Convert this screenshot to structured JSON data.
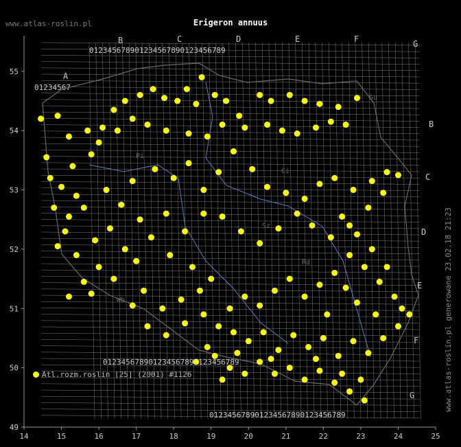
{
  "title": "Erigeron annuus",
  "site_label": "www.atlas-roslin.pl",
  "credit": "www.atlas-roslin.pl generowane 23.02.18 21:23",
  "legend": {
    "label": "Atl.rozm.roslin [25] (2001) #1126",
    "color": "#ffff00"
  },
  "colors": {
    "background": "#000000",
    "grid": "#7f7f7f",
    "dot": "#ffff00",
    "border": "#5f7fc0",
    "axis": "#999999"
  },
  "chart_data": {
    "type": "scatter",
    "xlim": [
      14,
      25
    ],
    "ylim": [
      49,
      55.6
    ],
    "x_ticks": [
      14,
      15,
      16,
      17,
      18,
      19,
      20,
      21,
      22,
      23,
      24,
      25
    ],
    "y_ticks": [
      49,
      50,
      51,
      52,
      53,
      54,
      55
    ],
    "grid_letters_top": [
      "A",
      "B",
      "C",
      "D",
      "E",
      "F",
      "G"
    ],
    "grid_letters_right": [
      "B",
      "C",
      "D",
      "E",
      "F",
      "G"
    ],
    "grid_digits": "0123456789",
    "river_labels": [
      "Su",
      "Pi",
      "Ci",
      "Sz",
      "Rd",
      "Wb"
    ],
    "points": [
      [
        14.45,
        54.2
      ],
      [
        14.9,
        54.25
      ],
      [
        15.2,
        53.9
      ],
      [
        15.7,
        54.0
      ],
      [
        16.0,
        53.8
      ],
      [
        16.1,
        54.05
      ],
      [
        16.4,
        54.35
      ],
      [
        16.7,
        54.5
      ],
      [
        17.1,
        54.6
      ],
      [
        17.45,
        54.7
      ],
      [
        17.75,
        54.55
      ],
      [
        18.1,
        54.5
      ],
      [
        18.35,
        54.7
      ],
      [
        18.75,
        54.9
      ],
      [
        18.6,
        54.45
      ],
      [
        19.1,
        54.6
      ],
      [
        19.4,
        54.5
      ],
      [
        19.75,
        54.25
      ],
      [
        20.3,
        54.6
      ],
      [
        20.6,
        54.5
      ],
      [
        21.1,
        54.6
      ],
      [
        21.5,
        54.5
      ],
      [
        21.9,
        54.45
      ],
      [
        22.4,
        54.4
      ],
      [
        22.9,
        54.55
      ],
      [
        22.6,
        54.1
      ],
      [
        22.2,
        54.15
      ],
      [
        21.8,
        54.05
      ],
      [
        21.3,
        53.95
      ],
      [
        20.9,
        54.0
      ],
      [
        20.5,
        54.1
      ],
      [
        19.9,
        54.05
      ],
      [
        19.3,
        54.1
      ],
      [
        18.9,
        53.9
      ],
      [
        18.4,
        53.95
      ],
      [
        17.8,
        54.0
      ],
      [
        17.3,
        54.1
      ],
      [
        16.9,
        54.2
      ],
      [
        16.5,
        54.0
      ],
      [
        15.8,
        53.6
      ],
      [
        15.3,
        53.4
      ],
      [
        14.7,
        53.2
      ],
      [
        14.6,
        53.55
      ],
      [
        15.0,
        53.05
      ],
      [
        15.4,
        52.9
      ],
      [
        14.8,
        52.7
      ],
      [
        15.2,
        52.55
      ],
      [
        15.6,
        52.7
      ],
      [
        15.1,
        52.3
      ],
      [
        14.9,
        52.05
      ],
      [
        15.4,
        51.9
      ],
      [
        15.9,
        52.15
      ],
      [
        16.3,
        52.35
      ],
      [
        16.7,
        52.0
      ],
      [
        16.0,
        51.7
      ],
      [
        15.6,
        51.45
      ],
      [
        15.2,
        51.2
      ],
      [
        15.8,
        51.25
      ],
      [
        16.4,
        51.5
      ],
      [
        17.0,
        51.8
      ],
      [
        17.4,
        52.2
      ],
      [
        17.1,
        52.5
      ],
      [
        16.6,
        52.75
      ],
      [
        16.2,
        53.0
      ],
      [
        16.9,
        53.15
      ],
      [
        17.5,
        53.35
      ],
      [
        18.0,
        53.2
      ],
      [
        18.4,
        53.45
      ],
      [
        18.8,
        53.0
      ],
      [
        19.2,
        53.3
      ],
      [
        19.6,
        53.65
      ],
      [
        20.1,
        53.35
      ],
      [
        20.5,
        53.05
      ],
      [
        21.0,
        52.95
      ],
      [
        21.5,
        52.85
      ],
      [
        21.9,
        53.1
      ],
      [
        22.3,
        53.2
      ],
      [
        22.8,
        53.0
      ],
      [
        23.3,
        53.15
      ],
      [
        23.7,
        53.3
      ],
      [
        24.0,
        53.25
      ],
      [
        23.6,
        52.95
      ],
      [
        23.2,
        52.7
      ],
      [
        22.7,
        52.4
      ],
      [
        22.2,
        52.2
      ],
      [
        21.7,
        52.4
      ],
      [
        21.3,
        52.6
      ],
      [
        20.8,
        52.35
      ],
      [
        20.3,
        52.1
      ],
      [
        19.8,
        52.3
      ],
      [
        19.3,
        52.55
      ],
      [
        18.8,
        52.6
      ],
      [
        18.3,
        52.3
      ],
      [
        17.8,
        52.6
      ],
      [
        17.9,
        51.9
      ],
      [
        18.5,
        51.7
      ],
      [
        19.0,
        51.5
      ],
      [
        18.7,
        51.3
      ],
      [
        18.2,
        51.15
      ],
      [
        17.7,
        51.0
      ],
      [
        17.2,
        51.3
      ],
      [
        16.9,
        51.05
      ],
      [
        17.3,
        50.7
      ],
      [
        17.8,
        50.55
      ],
      [
        18.3,
        50.75
      ],
      [
        18.8,
        50.9
      ],
      [
        19.2,
        50.7
      ],
      [
        19.6,
        50.6
      ],
      [
        20.0,
        50.45
      ],
      [
        20.4,
        50.6
      ],
      [
        20.8,
        50.3
      ],
      [
        21.2,
        50.55
      ],
      [
        21.6,
        50.35
      ],
      [
        22.0,
        50.5
      ],
      [
        22.4,
        50.2
      ],
      [
        22.8,
        50.45
      ],
      [
        23.2,
        50.25
      ],
      [
        23.6,
        50.5
      ],
      [
        24.0,
        50.7
      ],
      [
        23.9,
        51.2
      ],
      [
        23.5,
        51.45
      ],
      [
        23.1,
        51.7
      ],
      [
        22.7,
        51.9
      ],
      [
        22.3,
        51.6
      ],
      [
        21.9,
        51.4
      ],
      [
        21.5,
        51.2
      ],
      [
        21.1,
        51.5
      ],
      [
        20.7,
        51.3
      ],
      [
        20.3,
        51.05
      ],
      [
        19.9,
        51.2
      ],
      [
        19.5,
        51.0
      ],
      [
        19.1,
        50.2
      ],
      [
        19.5,
        50.0
      ],
      [
        19.9,
        49.9
      ],
      [
        20.3,
        50.1
      ],
      [
        20.7,
        49.9
      ],
      [
        21.1,
        50.0
      ],
      [
        21.5,
        49.8
      ],
      [
        21.9,
        49.95
      ],
      [
        22.3,
        49.75
      ],
      [
        22.7,
        49.6
      ],
      [
        23.1,
        49.45
      ],
      [
        22.5,
        49.9
      ],
      [
        21.8,
        50.15
      ],
      [
        20.6,
        50.15
      ],
      [
        19.7,
        50.25
      ],
      [
        18.9,
        50.35
      ],
      [
        18.6,
        50.1
      ],
      [
        19.3,
        49.8
      ],
      [
        23.4,
        50.9
      ],
      [
        22.9,
        51.1
      ],
      [
        22.6,
        51.35
      ],
      [
        24.1,
        51.0
      ],
      [
        23.7,
        51.7
      ],
      [
        23.3,
        52.0
      ],
      [
        22.9,
        52.25
      ],
      [
        22.5,
        52.55
      ],
      [
        24.3,
        50.9
      ],
      [
        23.0,
        49.8
      ],
      [
        22.1,
        50.9
      ]
    ]
  }
}
